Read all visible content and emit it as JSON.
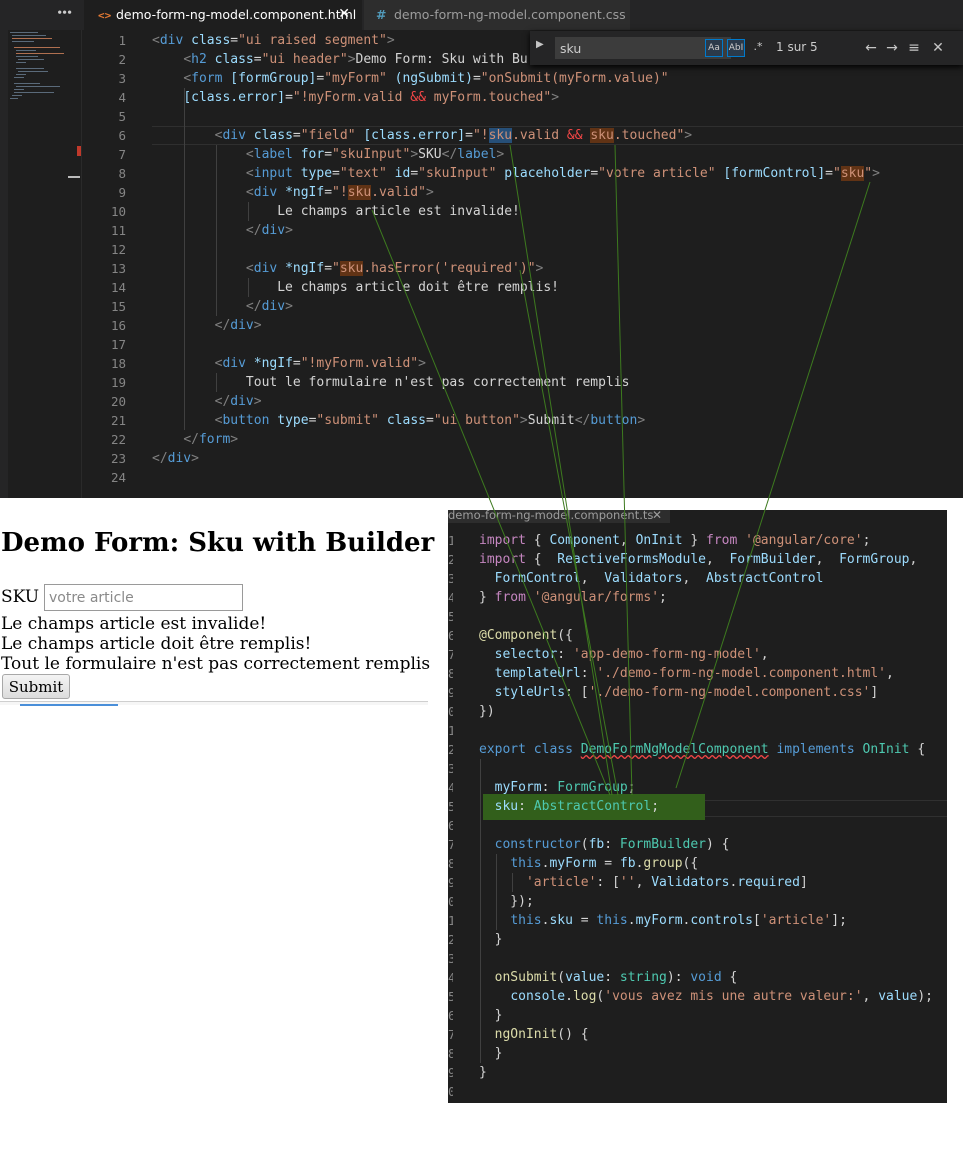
{
  "top_editor": {
    "menu_glyph": "•••",
    "tabs": [
      {
        "icon": "<>",
        "label": "demo-form-ng-model.component.html",
        "close": "✕"
      },
      {
        "icon": "#",
        "label": "demo-form-ng-model.component.css"
      }
    ],
    "line_numbers": [
      "1",
      "2",
      "3",
      "4",
      "5",
      "6",
      "7",
      "8",
      "9",
      "10",
      "11",
      "12",
      "13",
      "14",
      "15",
      "16",
      "17",
      "18",
      "19",
      "20",
      "21",
      "22",
      "23",
      "24"
    ],
    "find": {
      "toggle": "▶",
      "query": "sku",
      "opt_case": "Aa",
      "opt_word": "AbI",
      "opt_regex": ".*",
      "count": "1 sur 5",
      "prev": "←",
      "next": "→",
      "in_selection": "≡",
      "close": "✕"
    }
  },
  "preview": {
    "title": "Demo Form: Sku with Builder",
    "sku_label": "SKU",
    "sku_placeholder": "votre article",
    "msg_invalid": "Le champs article est invalide!",
    "msg_required": "Le champs article doit être remplis!",
    "msg_form": "Tout le formulaire n'est pas correctement remplis",
    "submit_label": "Submit"
  },
  "ts_editor": {
    "tab_label": "demo-form-ng-model.component.ts",
    "tab_close": "✕",
    "line_numbers": [
      "1",
      "2",
      "3",
      "4",
      "5",
      "6",
      "7",
      "8",
      "9",
      "0",
      "1",
      "2",
      "3",
      "4",
      "5",
      "6",
      "7",
      "8",
      "9",
      "0",
      "1",
      "2",
      "3",
      "4",
      "5",
      "6",
      "7",
      "8",
      "9",
      "0"
    ]
  }
}
